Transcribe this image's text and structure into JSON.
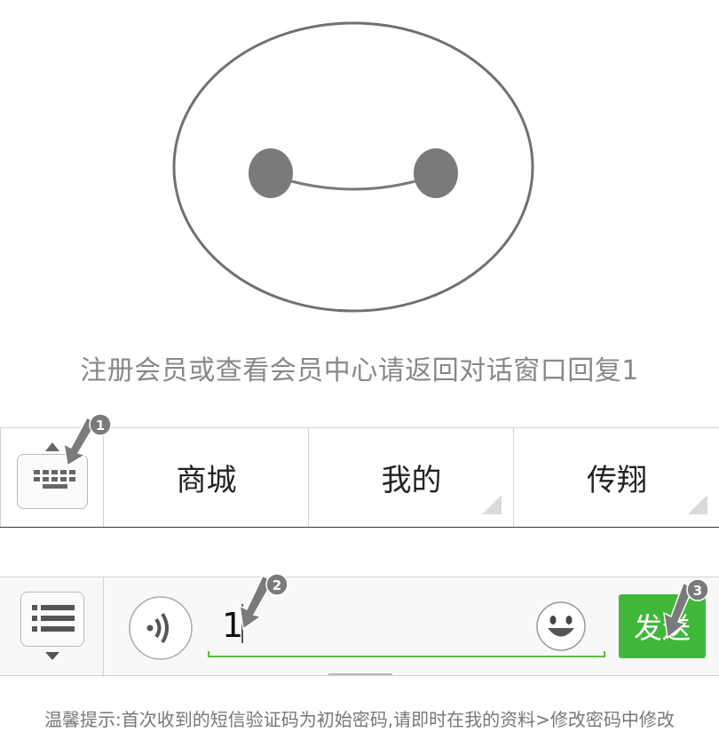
{
  "instruction_text": "注册会员或查看会员中心请返回对话窗口回复1",
  "menu": {
    "items": [
      {
        "label": "商城"
      },
      {
        "label": "我的"
      },
      {
        "label": "传翔"
      }
    ]
  },
  "input": {
    "value": "1",
    "send_label": "发送"
  },
  "tip_text": "温馨提示:首次收到的短信验证码为初始密码,请即时在我的资料>修改密码中修改",
  "annotations": [
    "1",
    "2",
    "3"
  ],
  "colors": {
    "send_button": "#3fb83a",
    "input_underline": "#5cbc3a",
    "annotation_arrow": "#7a7a7a"
  }
}
